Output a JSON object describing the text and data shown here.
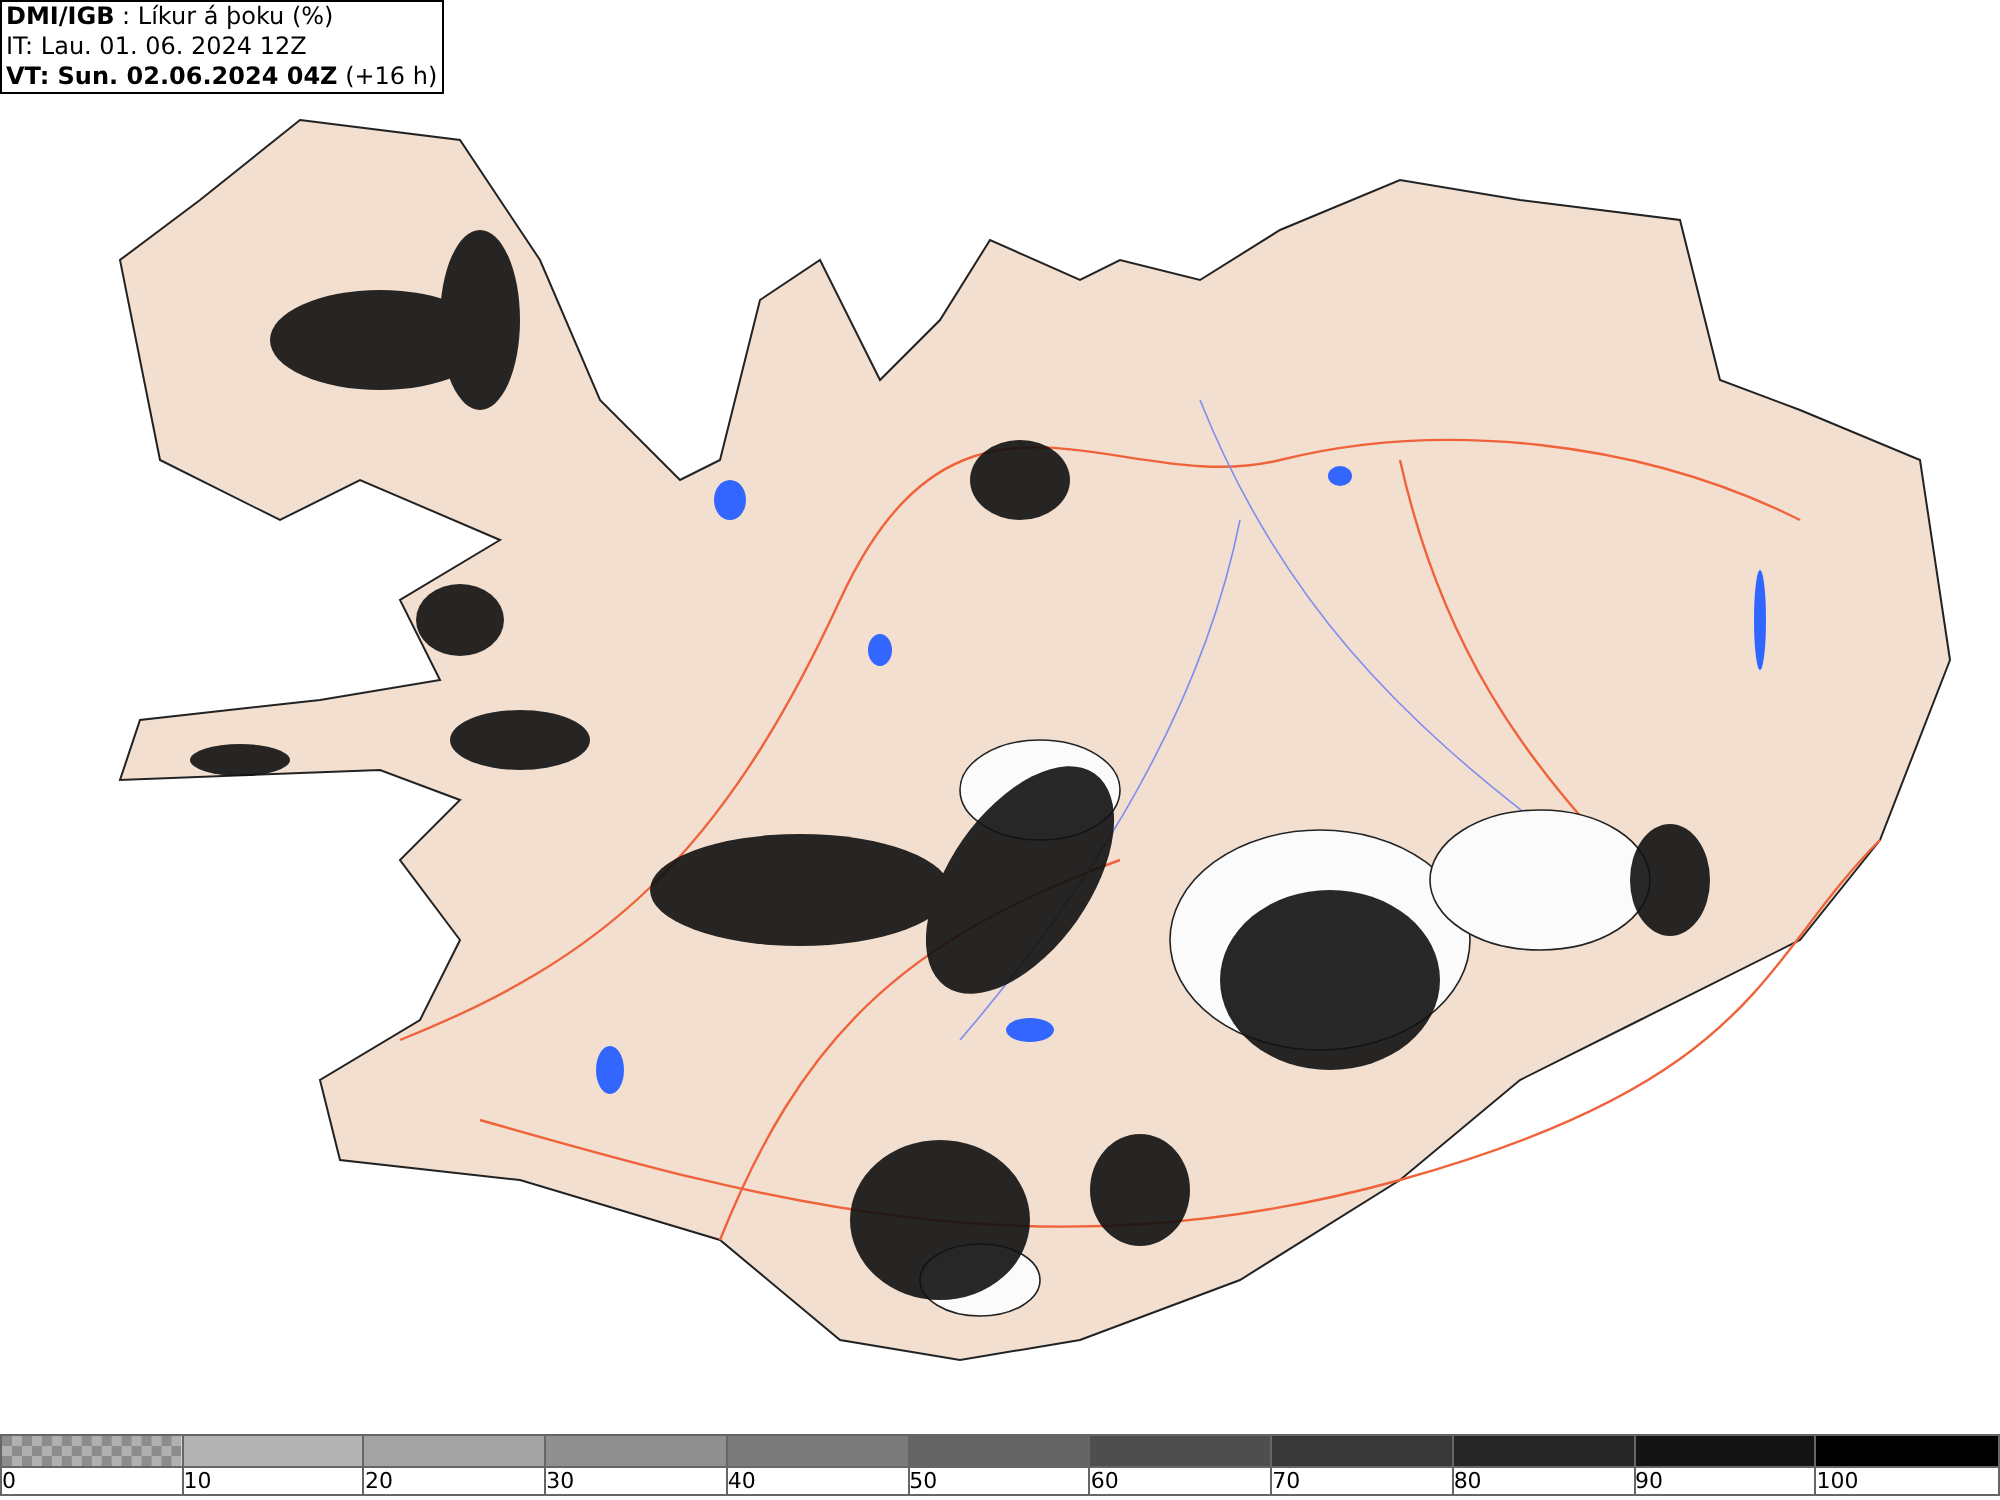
{
  "header": {
    "title_line": "**DMI/IGB** : Líkur á þoku (%)",
    "issue_time": "IT: Lau. 01. 06. 2024 12Z",
    "valid_time": "**VT: Sun. 02.06.2024 04Z** (+16 h)"
  },
  "legend": {
    "segments": [
      {
        "kind": "checker",
        "color": "#8c8c8c",
        "label": "0"
      },
      {
        "kind": "solid",
        "color": "#b3b3b3",
        "label": "10"
      },
      {
        "kind": "solid",
        "color": "#a3a3a3",
        "label": "20"
      },
      {
        "kind": "solid",
        "color": "#8f8f8f",
        "label": "30"
      },
      {
        "kind": "solid",
        "color": "#7b7b7b",
        "label": "40"
      },
      {
        "kind": "solid",
        "color": "#646464",
        "label": "50"
      },
      {
        "kind": "solid",
        "color": "#4e4e4e",
        "label": "60"
      },
      {
        "kind": "solid",
        "color": "#383838",
        "label": "70"
      },
      {
        "kind": "solid",
        "color": "#262626",
        "label": "80"
      },
      {
        "kind": "solid",
        "color": "#141414",
        "label": "90"
      },
      {
        "kind": "solid",
        "color": "#000000",
        "label": "100"
      }
    ]
  }
}
